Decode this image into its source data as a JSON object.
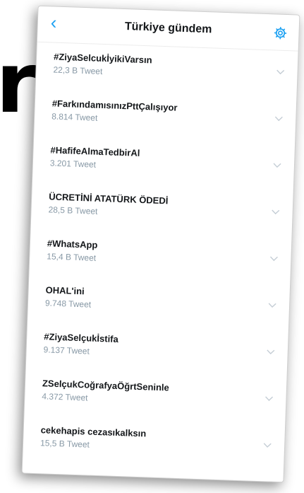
{
  "background_text": "r",
  "header": {
    "title": "Türkiye gündem",
    "back_icon": "chevron-left-icon",
    "settings_icon": "gear-icon"
  },
  "colors": {
    "accent": "#1da1f2",
    "secondary_text": "#8899a6"
  },
  "trends": [
    {
      "name": "#ZiyaSelcukİyikiVarsın",
      "count": "22,3 B Tweet"
    },
    {
      "name": "#FarkındamısınızPttÇalışıyor",
      "count": "8.814 Tweet"
    },
    {
      "name": "#HafifeAlmaTedbirAl",
      "count": "3.201 Tweet"
    },
    {
      "name": "ÜCRETİNİ ATATÜRK ÖDEDİ",
      "count": "28,5 B Tweet"
    },
    {
      "name": "#WhatsApp",
      "count": "15,4 B Tweet"
    },
    {
      "name": "OHAL'ini",
      "count": "9.748 Tweet"
    },
    {
      "name": "#ZiyaSelçukİstifa",
      "count": "9.137 Tweet"
    },
    {
      "name": "ZSelçukCoğrafyaÖğrtSeninle",
      "count": "4.372 Tweet"
    },
    {
      "name": "cekehapis cezasıkalksın",
      "count": "15,5 B Tweet"
    }
  ]
}
